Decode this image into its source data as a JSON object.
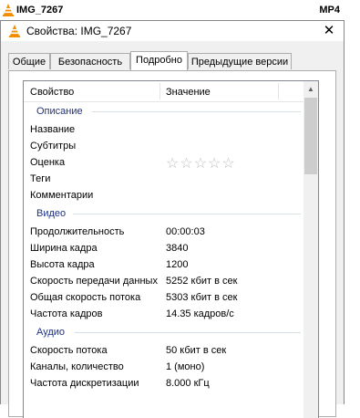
{
  "file": {
    "name": "IMG_7267",
    "type": "MP4"
  },
  "dialog": {
    "title": "Свойства: IMG_7267",
    "close_symbol": "✕",
    "tabs": [
      {
        "label": "Общие",
        "active": false
      },
      {
        "label": "Безопасность",
        "active": false
      },
      {
        "label": "Подробно",
        "active": true
      },
      {
        "label": "Предыдущие версии",
        "active": false
      }
    ],
    "columns": {
      "property": "Свойство",
      "value": "Значение"
    },
    "groups": {
      "description": {
        "label": "Описание",
        "rows": [
          {
            "prop": "Название",
            "val": ""
          },
          {
            "prop": "Субтитры",
            "val": ""
          },
          {
            "prop": "Оценка",
            "rating": 0,
            "max": 5
          },
          {
            "prop": "Теги",
            "val": ""
          },
          {
            "prop": "Комментарии",
            "val": ""
          }
        ]
      },
      "video": {
        "label": "Видео",
        "rows": [
          {
            "prop": "Продолжительность",
            "val": "00:00:03"
          },
          {
            "prop": "Ширина кадра",
            "val": "3840"
          },
          {
            "prop": "Высота кадра",
            "val": "1200"
          },
          {
            "prop": "Скорость передачи данных",
            "val": "5252 кбит в сек"
          },
          {
            "prop": "Общая скорость потока",
            "val": "5303 кбит в сек"
          },
          {
            "prop": "Частота кадров",
            "val": "14.35 кадров/с"
          }
        ]
      },
      "audio": {
        "label": "Аудио",
        "rows": [
          {
            "prop": "Скорость потока",
            "val": "50 кбит в сек"
          },
          {
            "prop": "Каналы, количество",
            "val": "1 (моно)"
          },
          {
            "prop": "Частота дискретизации",
            "val": "8.000 кГц"
          }
        ]
      }
    }
  },
  "colors": {
    "group_label": "#1e3287",
    "accent_cone": "#f28c00"
  }
}
